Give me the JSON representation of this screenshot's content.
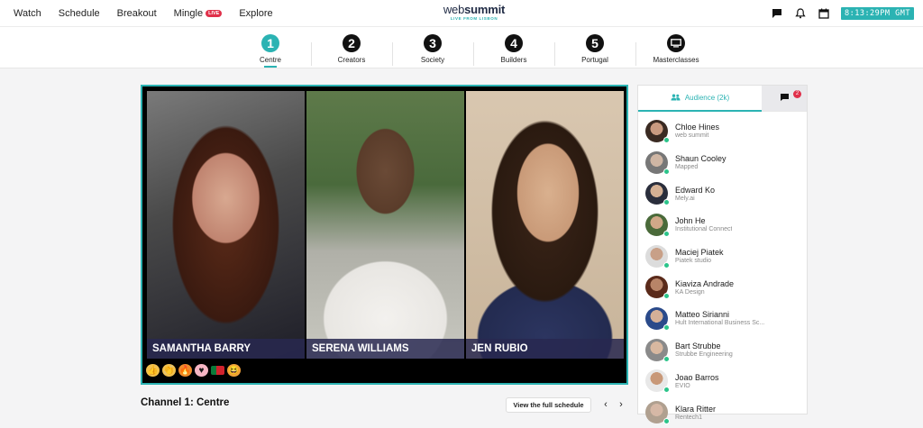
{
  "nav": {
    "items": [
      {
        "label": "Watch"
      },
      {
        "label": "Schedule"
      },
      {
        "label": "Breakout"
      },
      {
        "label": "Mingle",
        "badge": "LIVE"
      },
      {
        "label": "Explore"
      }
    ],
    "brand": {
      "name_light": "web",
      "name_bold": "summit",
      "tagline": "LIVE FROM LISBON"
    },
    "icons": [
      "chat-icon",
      "bell-icon",
      "calendar-icon"
    ],
    "clock": "8:13:29PM GMT"
  },
  "stages": [
    {
      "num": "1",
      "label": "Centre",
      "active": true
    },
    {
      "num": "2",
      "label": "Creators"
    },
    {
      "num": "3",
      "label": "Society"
    },
    {
      "num": "4",
      "label": "Builders"
    },
    {
      "num": "5",
      "label": "Portugal"
    },
    {
      "num": "",
      "label": "Masterclasses",
      "icon": "monitor-icon"
    }
  ],
  "video": {
    "speakers": [
      {
        "name": "SAMANTHA BARRY"
      },
      {
        "name": "SERENA WILLIAMS"
      },
      {
        "name": "JEN RUBIO"
      }
    ],
    "reactions": [
      "thumbs-up",
      "clap",
      "fire",
      "heart",
      "portugal-flag",
      "laugh"
    ]
  },
  "channel": {
    "title": "Channel 1: Centre",
    "schedule_button": "View the full schedule",
    "prev": "‹",
    "next": "›"
  },
  "sidebar": {
    "audience_tab": "Audience (2k)",
    "chat_badge": "2",
    "people": [
      {
        "name": "Chloe Hines",
        "company": "web summit"
      },
      {
        "name": "Shaun Cooley",
        "company": "Mapped"
      },
      {
        "name": "Edward Ko",
        "company": "Mely.ai"
      },
      {
        "name": "John He",
        "company": "Institutional Connect"
      },
      {
        "name": "Maciej Piatek",
        "company": "Piatek studio"
      },
      {
        "name": "Kiaviza Andrade",
        "company": "KA Design"
      },
      {
        "name": "Matteo Sirianni",
        "company": "Hult International Business Sc..."
      },
      {
        "name": "Bart Strubbe",
        "company": "Strubbe Engineering"
      },
      {
        "name": "Joao Barros",
        "company": "EVIO"
      },
      {
        "name": "Klara Ritter",
        "company": "Rentech1"
      }
    ]
  },
  "colors": {
    "accent": "#2bb3b3",
    "live": "#e0304a",
    "online": "#2bc48a"
  }
}
